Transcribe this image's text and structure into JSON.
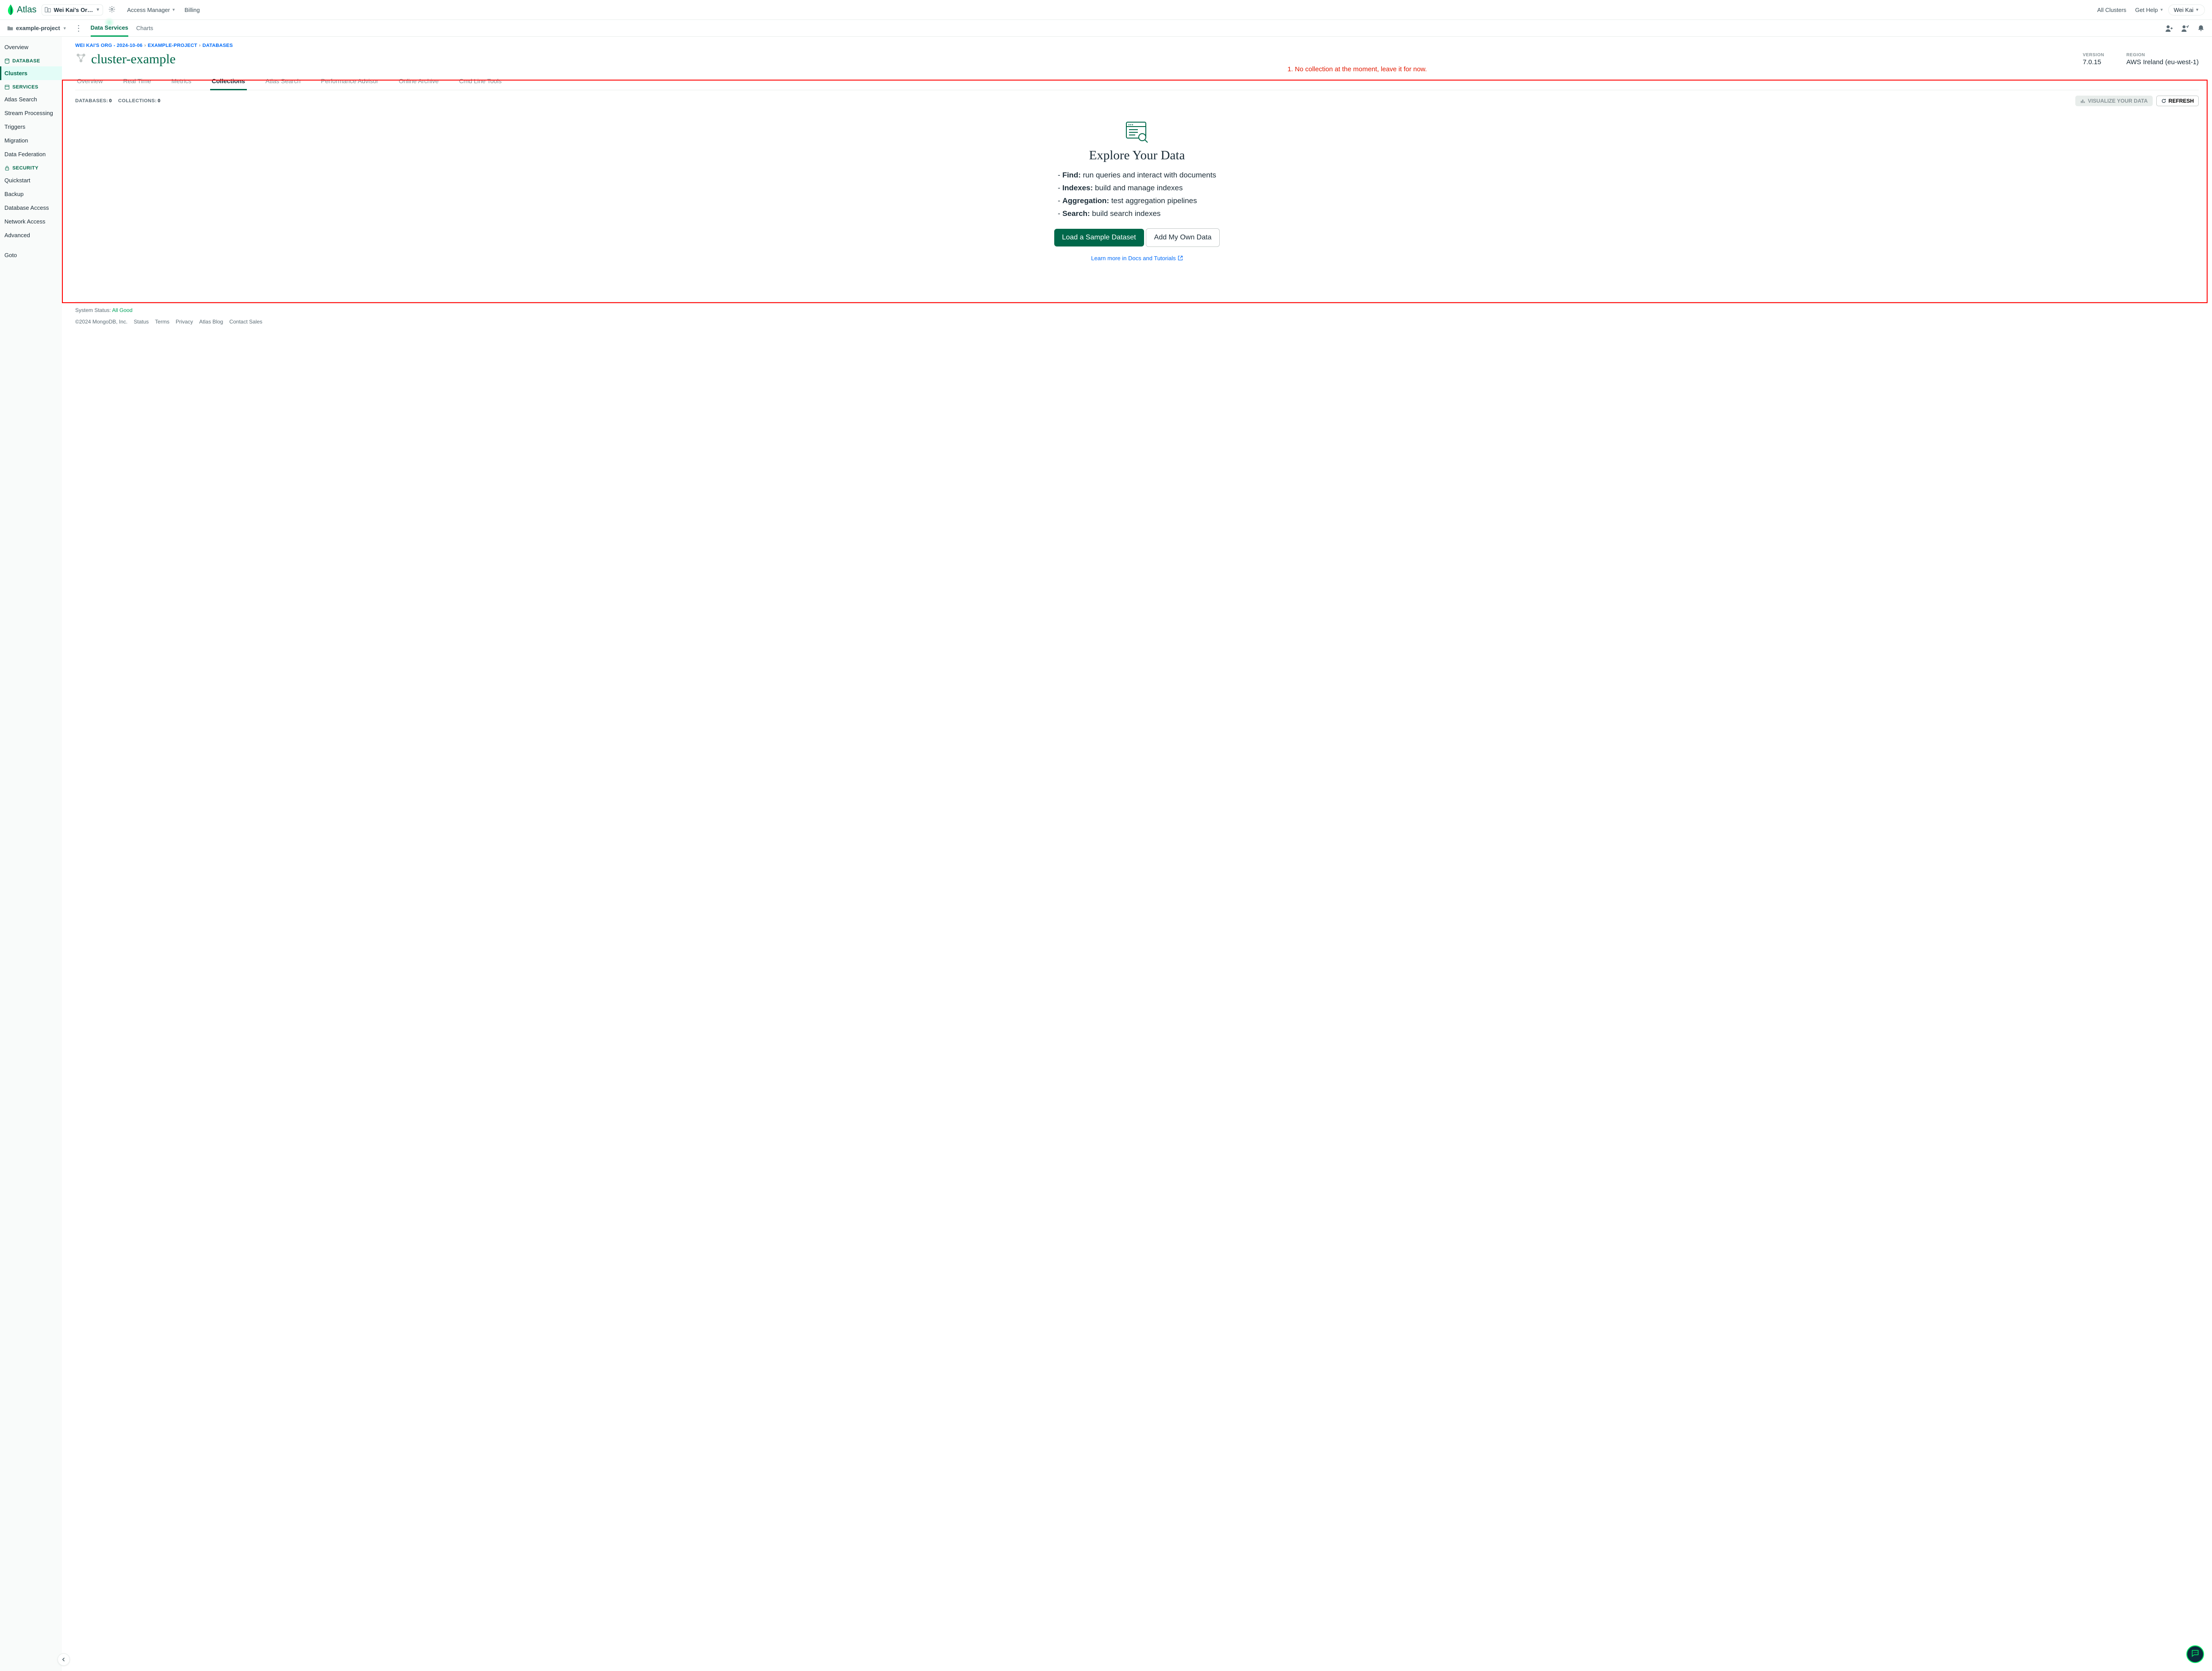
{
  "topbar": {
    "brand": "Atlas",
    "org_label": "Wei Kai's Or…",
    "access_manager": "Access Manager",
    "billing": "Billing",
    "all_clusters": "All Clusters",
    "get_help": "Get Help",
    "user_name": "Wei Kai"
  },
  "secondbar": {
    "project_name": "example-project",
    "tabs": {
      "data_services": "Data Services",
      "charts": "Charts"
    }
  },
  "sidenav": {
    "overview": "Overview",
    "sec_database": "DATABASE",
    "clusters": "Clusters",
    "sec_services": "SERVICES",
    "atlas_search": "Atlas Search",
    "stream_processing": "Stream Processing",
    "triggers": "Triggers",
    "migration": "Migration",
    "data_federation": "Data Federation",
    "sec_security": "SECURITY",
    "quickstart": "Quickstart",
    "backup": "Backup",
    "db_access": "Database Access",
    "net_access": "Network Access",
    "advanced": "Advanced",
    "goto": "Goto"
  },
  "breadcrumbs": {
    "org": "WEI KAI'S ORG - 2024-10-06",
    "project": "EXAMPLE-PROJECT",
    "section": "DATABASES"
  },
  "cluster": {
    "name": "cluster-example",
    "version_label": "VERSION",
    "version_value": "7.0.15",
    "region_label": "REGION",
    "region_value": "AWS Ireland (eu-west-1)"
  },
  "annotation": "1. No collection at the moment, leave it for now.",
  "ctabs": {
    "overview": "Overview",
    "realtime": "Real Time",
    "metrics": "Metrics",
    "collections": "Collections",
    "atlas_search": "Atlas Search",
    "perf": "Performance Advisor",
    "archive": "Online Archive",
    "cli": "Cmd Line Tools"
  },
  "stats": {
    "db_label": "DATABASES:",
    "db_count": "0",
    "coll_label": "COLLECTIONS:",
    "coll_count": "0",
    "visualize": "VISUALIZE YOUR DATA",
    "refresh": "REFRESH"
  },
  "empty": {
    "heading": "Explore Your Data",
    "f1_b": "Find:",
    "f1_t": " run queries and interact with documents",
    "f2_b": "Indexes:",
    "f2_t": " build and manage indexes",
    "f3_b": "Aggregation:",
    "f3_t": " test aggregation pipelines",
    "f4_b": "Search:",
    "f4_t": " build search indexes",
    "btn_sample": "Load a Sample Dataset",
    "btn_own": "Add My Own Data",
    "learn": "Learn more in Docs and Tutorials"
  },
  "footer": {
    "status_label": "System Status: ",
    "status_value": "All Good",
    "copyright": "©2024 MongoDB, Inc.",
    "links": [
      "Status",
      "Terms",
      "Privacy",
      "Atlas Blog",
      "Contact Sales"
    ]
  }
}
